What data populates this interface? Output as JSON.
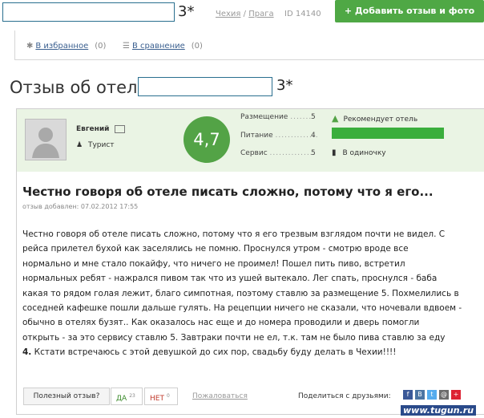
{
  "top": {
    "stars": "3*",
    "crumb_country": "Чехия",
    "crumb_sep": "/",
    "crumb_city": "Прага",
    "hotel_id": "ID 14140",
    "add_button": "+ Добавить отзыв и фото"
  },
  "fav": {
    "favorites_label": "В избранное",
    "favorites_count": "(0)",
    "compare_label": "В сравнение",
    "compare_count": "(0)"
  },
  "review": {
    "page_title": "Отзыв об отеле",
    "stars": "3*",
    "author_name": "Евгений",
    "author_type": "Турист",
    "rating": "4,7",
    "scores": [
      {
        "label": "Размещение",
        "dots": ".......",
        "value": "5"
      },
      {
        "label": "Питание",
        "dots": "..............",
        "value": "4"
      },
      {
        "label": "Сервис",
        "dots": "...............",
        "value": "5"
      }
    ],
    "recommends": "Рекомендует отель",
    "recommend_level": 1.0,
    "travel_type": "В одиночку",
    "headline": "Честно говоря об отеле писать сложно, потому что я его...",
    "added": "отзыв добавлен: 07.02.2012 17:55",
    "body_lines": [
      "Честно говоря об отеле писать сложно, потому что я его трезвым взглядом почти не видел. С",
      "рейса прилетел бухой как заселялись не помню. Проснулся утром - смотрю вроде все",
      "нормально и мне стало покайфу, что ничего не проимел! Пошел пить пиво, встретил",
      "нормальных ребят - нажрался пивом так что из ушей вытекало. Лег спать, проснулся - баба",
      "какая то рядом голая лежит, благо симпотная, поэтому ставлю за размещение 5. Похмелились в",
      "соседней кафешке пошли дальше гулять. На рецепции ничего не сказали, что ночевали вдвоем -",
      "обычно в отелях бузят.. Как оказалось нас еще и до номера проводили и дверь помогли",
      "открыть - за это сервису ставлю 5. Завтраки почти не ел, т.к. там не было пива ставлю за еду"
    ],
    "last_bold": "4.",
    "last_rest": " Кстати встречаюсь с этой девушкой до сих пор, свадьбу буду делать в Чехии!!!!"
  },
  "actions": {
    "useful": "Полезный отзыв?",
    "yes": "ДА",
    "yes_count": "23",
    "no": "НЕТ",
    "no_count": "0",
    "complain": "Пожаловаться",
    "share": "Поделиться с друзьями:",
    "social": [
      "f",
      "В",
      "t",
      "@",
      "+"
    ]
  },
  "watermark": "www.tugun.ru",
  "colors": {
    "accent_green": "#53a346",
    "panel_green": "#eaf4e4",
    "link_blue": "#3a5f8f"
  }
}
